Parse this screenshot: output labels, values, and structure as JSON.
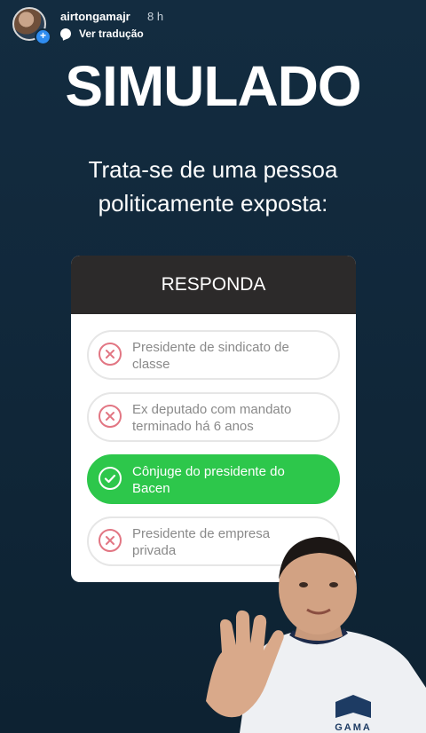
{
  "header": {
    "username": "airtongamajr",
    "time": "8 h",
    "translate_label": "Ver tradução"
  },
  "content": {
    "title": "SIMULADO",
    "question_line1": "Trata-se de uma pessoa",
    "question_line2": "politicamente exposta:"
  },
  "quiz": {
    "header": "RESPONDA",
    "options": [
      {
        "line1": "Presidente de sindicato de",
        "line2": "classe",
        "state": "wrong"
      },
      {
        "line1": "Ex deputado com mandato",
        "line2": "terminado há 6 anos",
        "state": "wrong"
      },
      {
        "line1": "Cônjuge do presidente do",
        "line2": "Bacen",
        "state": "correct"
      },
      {
        "line1": "Presidente de empresa",
        "line2": "privada",
        "state": "wrong"
      }
    ]
  },
  "presenter": {
    "shirt_logo_text": "GAMA"
  },
  "colors": {
    "background": "#132c40",
    "card_header": "#2c2a2a",
    "correct": "#2dc74b",
    "wrong_icon": "#e27683"
  }
}
